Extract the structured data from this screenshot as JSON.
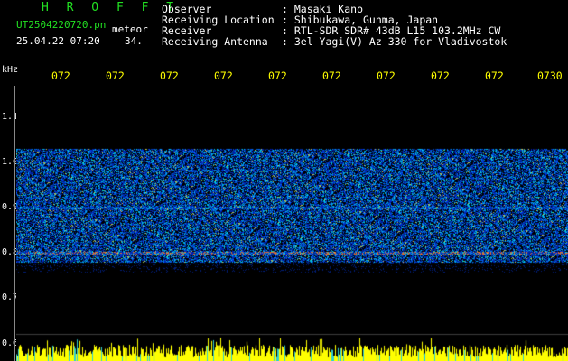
{
  "header": {
    "title": "H R O F F T",
    "file_name": "UT2504220720.pn",
    "meteor_label": "meteor",
    "datetime": "25.04.22 07:20",
    "meteor_count": "34."
  },
  "info": [
    {
      "label": "Observer",
      "value": ": Masaki Kano"
    },
    {
      "label": "Receiving Location",
      "value": ": Shibukawa, Gunma, Japan"
    },
    {
      "label": "Receiver",
      "value": ": RTL-SDR SDR# 43dB L15 103.2MHz CW"
    },
    {
      "label": "Receiving Antenna",
      "value": ": 3el Yagi(V) Az 330 for Vladivostok"
    }
  ],
  "yaxis": {
    "unit": "kHz",
    "labels": [
      "1.1",
      "1.0",
      "0.9",
      "0.8",
      "0.7",
      "0.6"
    ]
  },
  "xaxis": {
    "ticks": [
      "072",
      "072",
      "072",
      "072",
      "072",
      "072",
      "072",
      "072",
      "072",
      "0730"
    ]
  },
  "colors": {
    "title_green": "#22e022",
    "tick_yellow": "#ffff00",
    "background": "#000000",
    "noise_blue": "#1030c0"
  }
}
